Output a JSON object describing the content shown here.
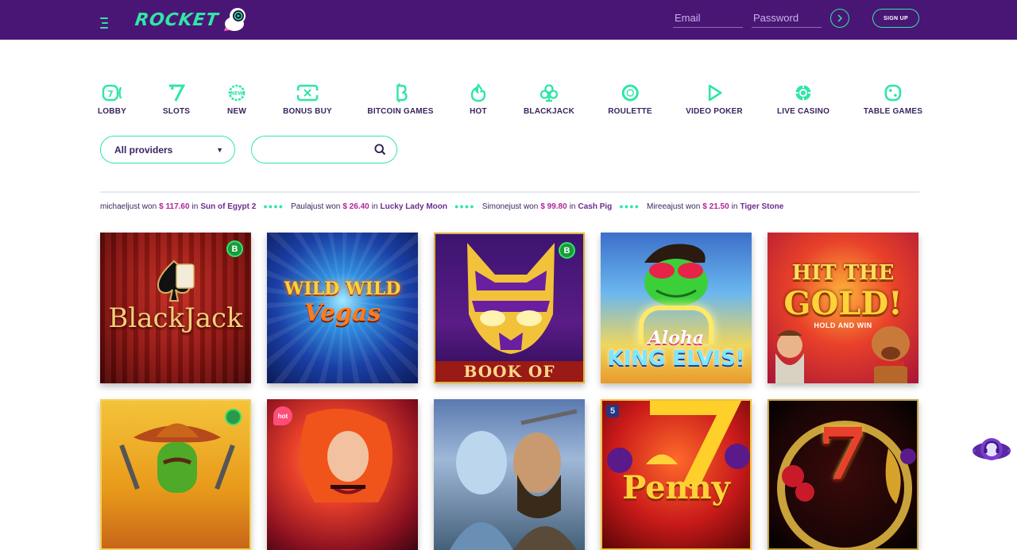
{
  "header": {
    "logo_text": "ROCKET",
    "email_placeholder": "Email",
    "password_placeholder": "Password",
    "login_icon": "chevron-right-icon",
    "signup_label": "SIGN UP"
  },
  "categories": [
    {
      "label": "LOBBY",
      "icon": "lobby-icon"
    },
    {
      "label": "SLOTS",
      "icon": "seven-icon"
    },
    {
      "label": "NEW",
      "icon": "new-icon"
    },
    {
      "label": "BONUS BUY",
      "icon": "bonus-buy-icon"
    },
    {
      "label": "BITCOIN GAMES",
      "icon": "bitcoin-icon"
    },
    {
      "label": "HOT",
      "icon": "fire-icon"
    },
    {
      "label": "BLACKJACK",
      "icon": "club-icon"
    },
    {
      "label": "ROULETTE",
      "icon": "roulette-icon"
    },
    {
      "label": "VIDEO POKER",
      "icon": "play-icon"
    },
    {
      "label": "LIVE CASINO",
      "icon": "chip-icon"
    },
    {
      "label": "TABLE GAMES",
      "icon": "dice-icon"
    }
  ],
  "filters": {
    "provider_value": "All providers",
    "search_placeholder": ""
  },
  "ticker": [
    {
      "user": "michael",
      "text": " just won",
      "amount": "$ 117.60",
      "in": "in",
      "game": "Sun of Egypt 2"
    },
    {
      "user": "Paula",
      "text": " just won",
      "amount": "$ 26.40",
      "in": "in",
      "game": "Lucky Lady Moon"
    },
    {
      "user": "Simone",
      "text": " just won",
      "amount": "$ 99.80",
      "in": "in",
      "game": "Cash Pig"
    },
    {
      "user": "Mireea",
      "text": " just won",
      "amount": "$ 21.50",
      "in": "in",
      "game": "Tiger Stone"
    }
  ],
  "games": [
    {
      "title": "BlackJack",
      "badge": "bitcoin"
    },
    {
      "title_line1": "WILD WILD",
      "title_line2": "Vegas",
      "badge": ""
    },
    {
      "title": "BOOK OF CATS",
      "badge": "bitcoin"
    },
    {
      "title_line1": "Aloha",
      "title_line2": "KING ELVIS!",
      "badge": ""
    },
    {
      "title_line1": "HIT THE",
      "title_line2": "GOLD!",
      "title_line3": "HOLD AND WIN",
      "badge": ""
    },
    {
      "title": "",
      "badge": "bitcoin"
    },
    {
      "title": "",
      "badge": "hot",
      "badge_text": "hot"
    },
    {
      "title": "",
      "badge": ""
    },
    {
      "title": "Penny",
      "badge": "5",
      "badge_text": "5"
    },
    {
      "title": "7",
      "badge": ""
    }
  ],
  "colors": {
    "header_bg": "#4a1675",
    "accent": "#2ee6a8",
    "amount": "#b1239b",
    "text": "#3a2460"
  }
}
